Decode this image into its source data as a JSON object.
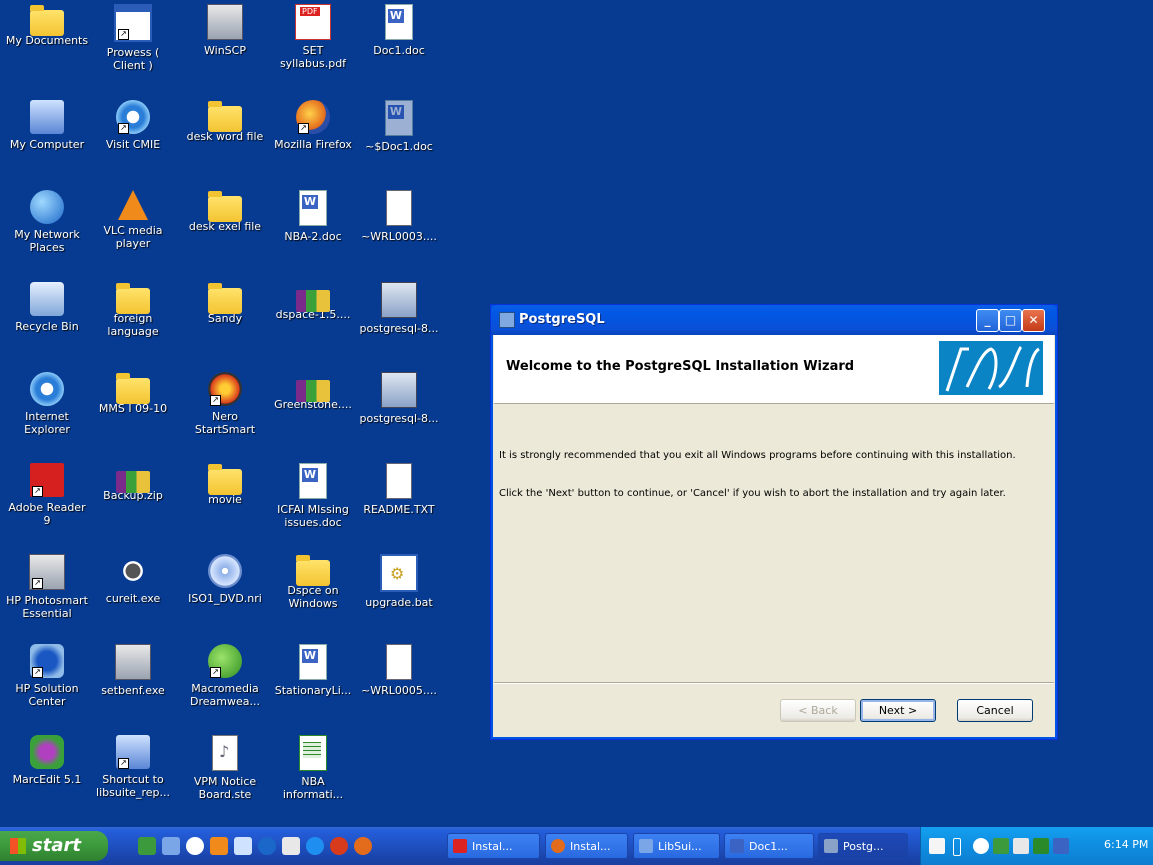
{
  "desktop": {
    "icons": [
      {
        "label": "My Documents",
        "icon": "my-documents-icon"
      },
      {
        "label": "Prowess ( Client )",
        "icon": "prowess-icon"
      },
      {
        "label": "WinSCP",
        "icon": "winscp-icon"
      },
      {
        "label": "SET syllabus.pdf",
        "icon": "pdf-icon"
      },
      {
        "label": "Doc1.doc",
        "icon": "word-doc-icon"
      },
      {
        "label": "My Computer",
        "icon": "my-computer-icon"
      },
      {
        "label": "Visit CMIE",
        "icon": "internet-explorer-icon"
      },
      {
        "label": "desk word file",
        "icon": "folder-icon"
      },
      {
        "label": "Mozilla Firefox",
        "icon": "firefox-icon"
      },
      {
        "label": "~$Doc1.doc",
        "icon": "word-doc-icon"
      },
      {
        "label": "My Network Places",
        "icon": "network-icon"
      },
      {
        "label": "VLC media player",
        "icon": "vlc-icon"
      },
      {
        "label": "desk exel file",
        "icon": "folder-icon"
      },
      {
        "label": "NBA-2.doc",
        "icon": "word-doc-icon"
      },
      {
        "label": "~WRL0003....",
        "icon": "file-icon"
      },
      {
        "label": "Recycle Bin",
        "icon": "recycle-bin-icon"
      },
      {
        "label": "foreign language",
        "icon": "folder-icon"
      },
      {
        "label": "Sandy",
        "icon": "folder-icon"
      },
      {
        "label": "dspace-1.5....",
        "icon": "zip-icon"
      },
      {
        "label": "postgresql-8...",
        "icon": "installer-icon"
      },
      {
        "label": "Internet Explorer",
        "icon": "internet-explorer-icon"
      },
      {
        "label": "MMS I 09-10",
        "icon": "folder-icon"
      },
      {
        "label": "Nero StartSmart",
        "icon": "nero-icon"
      },
      {
        "label": "Greenstone....",
        "icon": "zip-icon"
      },
      {
        "label": "postgresql-8...",
        "icon": "installer-icon"
      },
      {
        "label": "Adobe Reader 9",
        "icon": "adobe-reader-icon"
      },
      {
        "label": "Backup.zip",
        "icon": "zip-icon"
      },
      {
        "label": "movie",
        "icon": "folder-icon"
      },
      {
        "label": "ICFAI MIssing issues.doc",
        "icon": "word-doc-icon"
      },
      {
        "label": "README.TXT",
        "icon": "text-file-icon"
      },
      {
        "label": "HP Photosmart Essential",
        "icon": "hp-photosmart-icon"
      },
      {
        "label": "cureit.exe",
        "icon": "cureit-icon"
      },
      {
        "label": "ISO1_DVD.nri",
        "icon": "cd-icon"
      },
      {
        "label": "Dspce on Windows",
        "icon": "folder-icon"
      },
      {
        "label": "upgrade.bat",
        "icon": "batch-file-icon"
      },
      {
        "label": "HP Solution Center",
        "icon": "hp-solution-icon"
      },
      {
        "label": "setbenf.exe",
        "icon": "setup-icon"
      },
      {
        "label": "Macromedia Dreamwea...",
        "icon": "dreamweaver-icon"
      },
      {
        "label": "StationaryLi...",
        "icon": "word-doc-icon"
      },
      {
        "label": "~WRL0005....",
        "icon": "file-icon"
      },
      {
        "label": "MarcEdit 5.1",
        "icon": "marcedit-icon"
      },
      {
        "label": "Shortcut to libsuite_rep...",
        "icon": "shortcut-icon"
      },
      {
        "label": "VPM Notice Board.ste",
        "icon": "note-file-icon"
      },
      {
        "label": "NBA informati...",
        "icon": "excel-icon"
      }
    ]
  },
  "window": {
    "title": "PostgreSQL",
    "header_title": "Welcome to the PostgreSQL Installation Wizard",
    "body_line1": "It is strongly recommended that you exit all Windows programs before continuing with this installation.",
    "body_line2": "Click the 'Next' button to continue, or 'Cancel' if you wish to abort the installation and try again later.",
    "back_label": "< Back",
    "next_label": "Next >",
    "cancel_label": "Cancel",
    "minimize_glyph": "_",
    "maximize_glyph": "□",
    "close_glyph": "✕"
  },
  "taskbar": {
    "start_label": "start",
    "tasks": [
      {
        "label": "Instal...",
        "icon": "pdf-icon"
      },
      {
        "label": "Instal...",
        "icon": "firefox-icon"
      },
      {
        "label": "LibSui...",
        "icon": "app-icon"
      },
      {
        "label": "Doc1...",
        "icon": "word-doc-icon"
      },
      {
        "label": "Postg...",
        "icon": "installer-icon"
      }
    ],
    "clock": "6:14 PM"
  },
  "colors": {
    "desktop": "#073b91",
    "taskbar": "#245edb",
    "start": "#3c9a3c",
    "tray": "#0f8de0",
    "window_face": "#ece9d8"
  }
}
